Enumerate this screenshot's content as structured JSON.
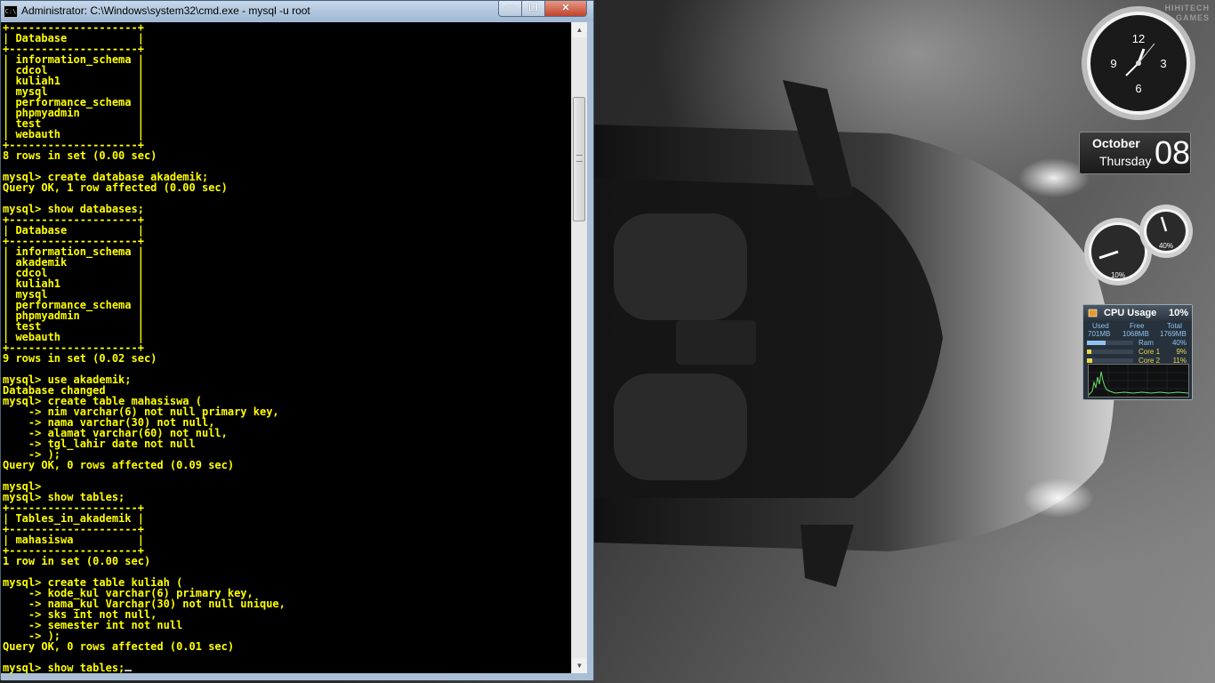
{
  "window": {
    "title": "Administrator: C:\\Windows\\system32\\cmd.exe - mysql  -u root",
    "icon_text": "C:\\",
    "buttons": {
      "minimize_icon": "minimize-icon",
      "maximize_icon": "maximize-icon",
      "close_icon": "close-icon"
    }
  },
  "console": {
    "text_color": "#ffff00",
    "background": "#000000",
    "lines": [
      "+--------------------+",
      "| Database           |",
      "+--------------------+",
      "| information_schema |",
      "| cdcol              |",
      "| kuliah1            |",
      "| mysql              |",
      "| performance_schema |",
      "| phpmyadmin         |",
      "| test               |",
      "| webauth            |",
      "+--------------------+",
      "8 rows in set (0.00 sec)",
      "",
      "mysql> create database akademik;",
      "Query OK, 1 row affected (0.00 sec)",
      "",
      "mysql> show databases;",
      "+--------------------+",
      "| Database           |",
      "+--------------------+",
      "| information_schema |",
      "| akademik           |",
      "| cdcol              |",
      "| kuliah1            |",
      "| mysql              |",
      "| performance_schema |",
      "| phpmyadmin         |",
      "| test               |",
      "| webauth            |",
      "+--------------------+",
      "9 rows in set (0.02 sec)",
      "",
      "mysql> use akademik;",
      "Database changed",
      "mysql> create table mahasiswa (",
      "    -> nim varchar(6) not null primary key,",
      "    -> nama varchar(30) not null,",
      "    -> alamat varchar(60) not null,",
      "    -> tgl_lahir date not null",
      "    -> );",
      "Query OK, 0 rows affected (0.09 sec)",
      "",
      "mysql>",
      "mysql> show tables;",
      "+--------------------+",
      "| Tables_in_akademik |",
      "+--------------------+",
      "| mahasiswa          |",
      "+--------------------+",
      "1 row in set (0.00 sec)",
      "",
      "mysql> create table kuliah (",
      "    -> kode_kul varchar(6) primary key,",
      "    -> nama_kul Varchar(30) not null unique,",
      "    -> sks int not null,",
      "    -> semester int not null",
      "    -> );",
      "Query OK, 0 rows affected (0.01 sec)",
      ""
    ],
    "current_input": "mysql> show tables;"
  },
  "scrollbar": {
    "up_icon": "scroll-up-arrow-icon",
    "down_icon": "scroll-down-arrow-icon",
    "position_fraction": 0.12
  },
  "desktop": {
    "watermark": "HIHITECH\nGAMES",
    "wallpaper_icon": "sports-car-wallpaper"
  },
  "clock_gadget": {
    "numerals": [
      "12",
      "3",
      "6",
      "9"
    ],
    "time": "1:08"
  },
  "calendar_gadget": {
    "month": "October",
    "weekday": "Thursday",
    "day": "08"
  },
  "meter_gadget": {
    "cpu_label": "10%",
    "ram_label": "40%",
    "cpu_value": 10,
    "ram_value": 40
  },
  "cpu_gadget": {
    "title": "CPU Usage",
    "percent": "10%",
    "headers": {
      "used": "Used",
      "free": "Free",
      "total": "Total"
    },
    "values": {
      "used": "701MB",
      "free": "1068MB",
      "total": "1769MB"
    },
    "rows": [
      {
        "name": "Ram",
        "value": "40%",
        "fraction": 0.4,
        "color": "#8fc3ee"
      },
      {
        "name": "Core 1",
        "value": "9%",
        "fraction": 0.09,
        "color": "#e8d84a"
      },
      {
        "name": "Core 2",
        "value": "11%",
        "fraction": 0.11,
        "color": "#e8d84a"
      }
    ],
    "graph_color": "#6fdc6f"
  }
}
